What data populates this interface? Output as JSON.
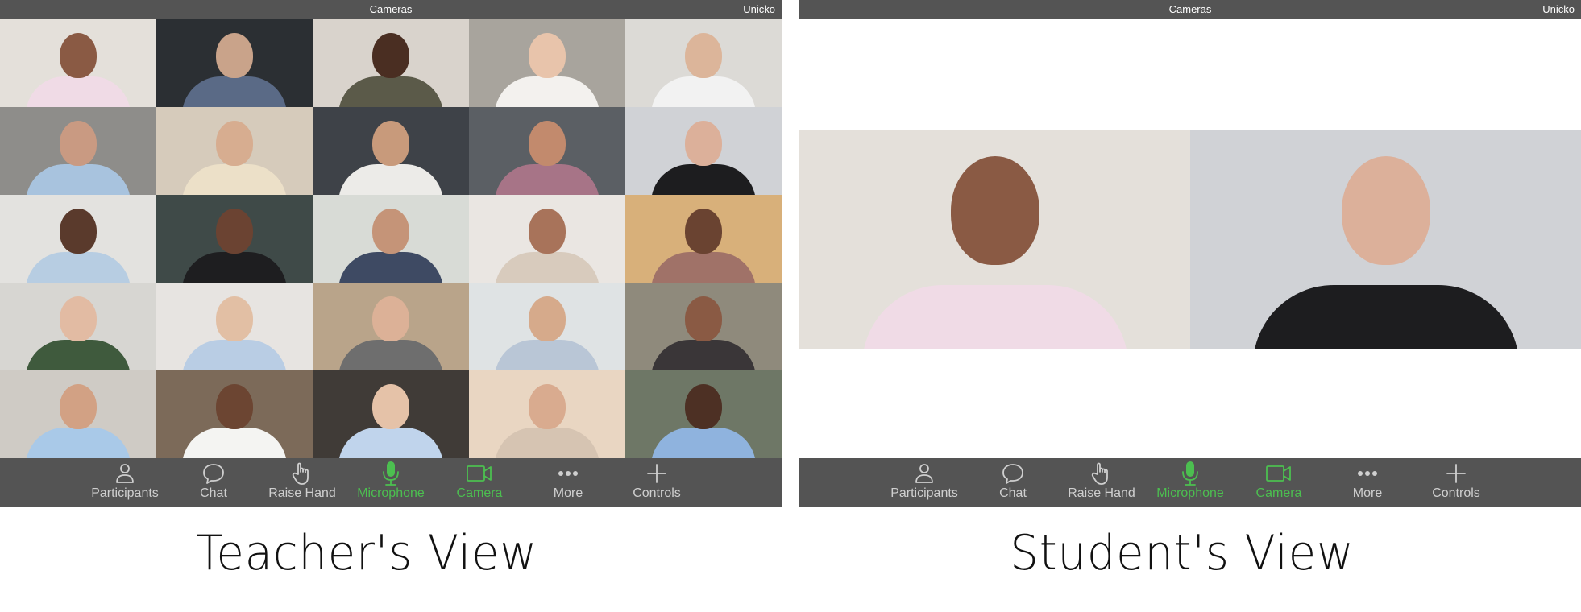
{
  "window": {
    "title": "Cameras",
    "user": "Unicko"
  },
  "toolbar": {
    "items": [
      {
        "label": "Participants",
        "icon": "person-icon",
        "active": false
      },
      {
        "label": "Chat",
        "icon": "chat-bubble-icon",
        "active": false
      },
      {
        "label": "Raise Hand",
        "icon": "hand-pointer-icon",
        "active": false
      },
      {
        "label": "Microphone",
        "icon": "microphone-icon",
        "active": true
      },
      {
        "label": "Camera",
        "icon": "video-camera-icon",
        "active": true
      },
      {
        "label": "More",
        "icon": "ellipsis-icon",
        "active": false
      },
      {
        "label": "Controls",
        "icon": "plus-icon",
        "active": false
      }
    ],
    "active_color": "#4cbf50",
    "inactive_color": "#cfcfcf",
    "background": "#545454"
  },
  "teacher_view": {
    "caption": "Teacher's View",
    "grid_columns": 5,
    "grid_rows": 5,
    "participants": [
      {
        "bg": "#e4e0da",
        "skin": "#8a5a44",
        "shirt": "#f0dbe6"
      },
      {
        "bg": "#2b2f33",
        "skin": "#c9a38a",
        "shirt": "#5a6a86"
      },
      {
        "bg": "#d9d3cc",
        "skin": "#4a2e22",
        "shirt": "#5b5a49"
      },
      {
        "bg": "#a8a49d",
        "skin": "#e8c4ab",
        "shirt": "#f3f1ee"
      },
      {
        "bg": "#dcdad6",
        "skin": "#dcb59a",
        "shirt": "#f2f2f2"
      },
      {
        "bg": "#8e8d8a",
        "skin": "#c99a82",
        "shirt": "#a8c3de"
      },
      {
        "bg": "#d6cbbb",
        "skin": "#d7ad90",
        "shirt": "#ece0c8"
      },
      {
        "bg": "#3e4248",
        "skin": "#c89a7b",
        "shirt": "#ecebe8"
      },
      {
        "bg": "#5b5f64",
        "skin": "#c28a6d",
        "shirt": "#a77487"
      },
      {
        "bg": "#d0d2d6",
        "skin": "#dcb09a",
        "shirt": "#1d1d1f"
      },
      {
        "bg": "#e3e2df",
        "skin": "#5a3a2c",
        "shirt": "#b7cde2"
      },
      {
        "bg": "#3f4a48",
        "skin": "#6b4332",
        "shirt": "#1e1e20"
      },
      {
        "bg": "#d8dbd6",
        "skin": "#c59478",
        "shirt": "#3e4a63"
      },
      {
        "bg": "#eae6e2",
        "skin": "#a8735a",
        "shirt": "#d8cbbd"
      },
      {
        "bg": "#d8b07a",
        "skin": "#6a4331",
        "shirt": "#a07268"
      },
      {
        "bg": "#d7d6d2",
        "skin": "#e2bba3",
        "shirt": "#3f5a3d"
      },
      {
        "bg": "#e7e4e1",
        "skin": "#e2bfa4",
        "shirt": "#b9cde4"
      },
      {
        "bg": "#b9a48a",
        "skin": "#dcb197",
        "shirt": "#6e6e6e"
      },
      {
        "bg": "#dfe3e4",
        "skin": "#d6aa8b",
        "shirt": "#b9c6d6"
      },
      {
        "bg": "#8f8a7c",
        "skin": "#8a5a44",
        "shirt": "#3a3638"
      },
      {
        "bg": "#cfcbc5",
        "skin": "#d2a184",
        "shirt": "#a9c9e8"
      },
      {
        "bg": "#7c6a59",
        "skin": "#6c4532",
        "shirt": "#f4f4f2"
      },
      {
        "bg": "#403b37",
        "skin": "#e5c2a8",
        "shirt": "#c0d4ec"
      },
      {
        "bg": "#e9d6c2",
        "skin": "#d9ab8f",
        "shirt": "#d6c4b2"
      },
      {
        "bg": "#6e7766",
        "skin": "#4d3024",
        "shirt": "#8fb3de"
      }
    ]
  },
  "student_view": {
    "caption": "Student's View",
    "stage": [
      {
        "bg": "#e4e0da",
        "skin": "#8a5a44",
        "shirt": "#f0dbe6"
      },
      {
        "bg": "#d0d2d6",
        "skin": "#dcb09a",
        "shirt": "#1d1d1f"
      }
    ]
  }
}
